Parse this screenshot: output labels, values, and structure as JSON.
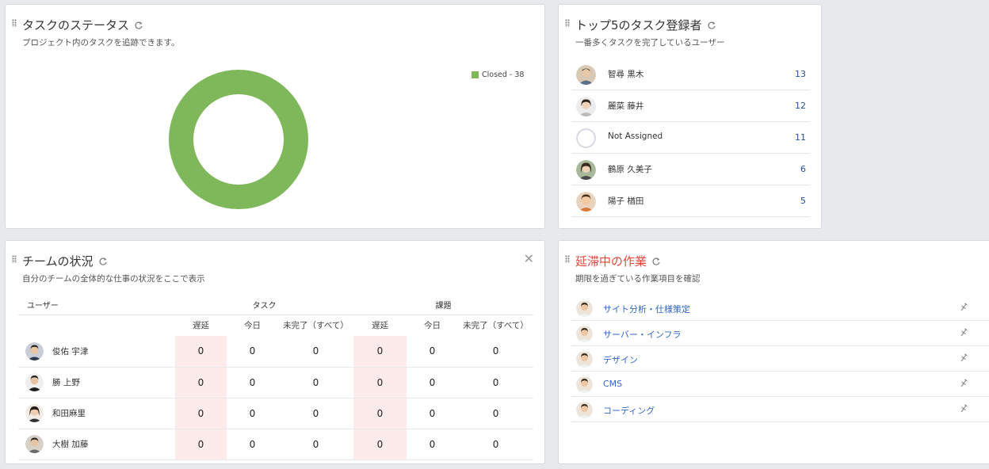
{
  "status_card": {
    "title": "タスクのステータス",
    "subtitle": "プロジェクト内のタスクを追跡できます。",
    "chart_data": {
      "type": "pie",
      "categories": [
        "Closed"
      ],
      "values": [
        38
      ],
      "legend": [
        "Closed - 38"
      ],
      "colors": [
        "#7fb85a"
      ]
    }
  },
  "top5_card": {
    "title": "トップ5のタスク登録者",
    "subtitle": "一番多くタスクを完了しているユーザー",
    "users": [
      {
        "name": "智尋 黒木",
        "count": "13"
      },
      {
        "name": "麗菜 藤井",
        "count": "12"
      },
      {
        "name": "Not Assigned",
        "count": "11"
      },
      {
        "name": "鶴原 久美子",
        "count": "6"
      },
      {
        "name": "陽子 楢田",
        "count": "5"
      }
    ]
  },
  "team_card": {
    "title": "チームの状況",
    "subtitle": "自分のチームの全体的な仕事の状況をここで表示",
    "headers": {
      "user": "ユーザー",
      "tasks": "タスク",
      "issues": "課題",
      "late": "遅延",
      "today": "今日",
      "incomplete": "未完了（すべて）"
    },
    "rows": [
      {
        "name": "俊佑 宇津",
        "values": [
          "0",
          "0",
          "0",
          "0",
          "0",
          "0"
        ]
      },
      {
        "name": "勝 上野",
        "values": [
          "0",
          "0",
          "0",
          "0",
          "0",
          "0"
        ]
      },
      {
        "name": "和田麻里",
        "values": [
          "0",
          "0",
          "0",
          "0",
          "0",
          "0"
        ]
      },
      {
        "name": "大樹 加藤",
        "values": [
          "0",
          "0",
          "0",
          "0",
          "0",
          "0"
        ]
      }
    ]
  },
  "delay_card": {
    "title": "延滞中の作業",
    "subtitle": "期限を過ぎている作業項目を確認",
    "items": [
      {
        "label": "サイト分析・仕様策定"
      },
      {
        "label": "サーバー・インフラ"
      },
      {
        "label": "デザイン"
      },
      {
        "label": "CMS"
      },
      {
        "label": "コーディング"
      }
    ]
  },
  "colors": {
    "accent_green": "#7fb85a",
    "link_blue": "#2f66c8",
    "count_blue": "#1f4e9c",
    "late_bg": "#fdebeb",
    "title_red": "#e3473b"
  }
}
